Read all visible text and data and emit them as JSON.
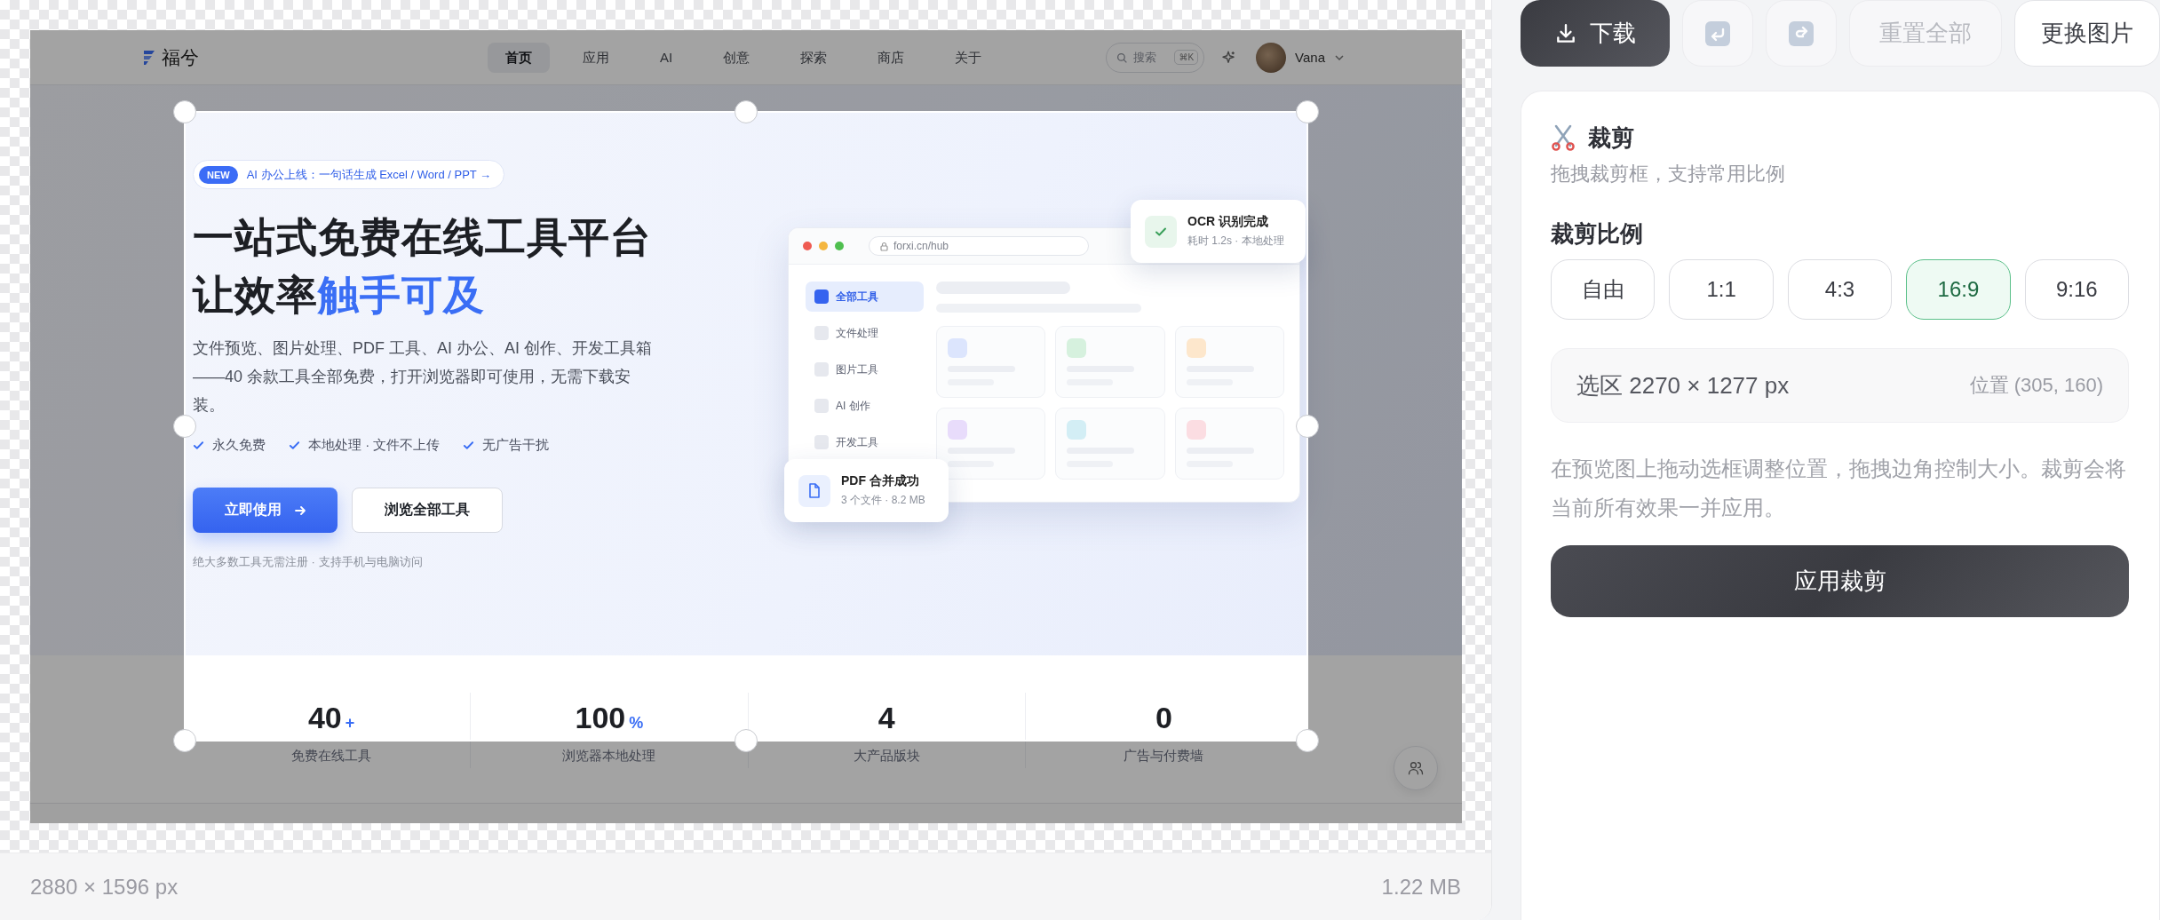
{
  "preview": {
    "nav": {
      "logo": "福兮",
      "items": [
        {
          "label": "首页",
          "selected": true
        },
        {
          "label": "应用",
          "selected": false
        },
        {
          "label": "AI",
          "selected": false
        },
        {
          "label": "创意",
          "selected": false
        },
        {
          "label": "探索",
          "selected": false
        },
        {
          "label": "商店",
          "selected": false
        },
        {
          "label": "关于",
          "selected": false
        }
      ],
      "search": {
        "placeholder": "搜索",
        "shortcut": "⌘K"
      },
      "user": "Vana"
    },
    "hero": {
      "badge_tag": "NEW",
      "badge_text": "AI 办公上线：一句话生成 Excel / Word / PPT →",
      "title_line_1": "一站式免费在线工具平台",
      "title_line_2": "让效率",
      "title_highlight": "触手可及",
      "description": "文件预览、图片处理、PDF 工具、AI 办公、AI 创作、开发工具箱——40 余款工具全部免费，打开浏览器即可使用，无需下载安装。",
      "features": [
        "永久免费",
        "本地处理 · 文件不上传",
        "无广告干扰"
      ],
      "primary_button": "立即使用",
      "secondary_button": "浏览全部工具",
      "note": "绝大多数工具无需注册 · 支持手机与电脑访问"
    },
    "mockup": {
      "url": "forxi.cn/hub",
      "sidebar": [
        {
          "label": "全部工具",
          "selected": true
        },
        {
          "label": "文件处理",
          "selected": false
        },
        {
          "label": "图片工具",
          "selected": false
        },
        {
          "label": "AI 创作",
          "selected": false
        },
        {
          "label": "开发工具",
          "selected": false
        }
      ],
      "cards": [
        {
          "color": "#dce5fd"
        },
        {
          "color": "#d6f1de"
        },
        {
          "color": "#fde7cc"
        },
        {
          "color": "#e8dcfb"
        },
        {
          "color": "#d3eef5"
        },
        {
          "color": "#fbdde2"
        }
      ]
    },
    "toasts": [
      {
        "kind": "success",
        "title": "OCR 识别完成",
        "detail": "耗时 1.2s · 本地处理"
      },
      {
        "kind": "file",
        "title": "PDF 合并成功",
        "detail": "3 个文件 · 8.2 MB"
      }
    ],
    "stats": [
      {
        "value": "40",
        "suffix": "+",
        "label": "免费在线工具"
      },
      {
        "value": "100",
        "suffix": "%",
        "label": "浏览器本地处理"
      },
      {
        "value": "4",
        "label": "大产品版块"
      },
      {
        "value": "0",
        "label": "广告与付费墙"
      }
    ]
  },
  "image_info": {
    "dimensions": "2880 × 1596 px",
    "size": "1.22 MB"
  },
  "toolbar": [
    {
      "kind": "download",
      "label": "下载",
      "disabled": false
    },
    {
      "kind": "undo",
      "disabled": true
    },
    {
      "kind": "redo",
      "disabled": true
    },
    {
      "kind": "reset",
      "label": "重置全部",
      "disabled": true
    },
    {
      "kind": "replace",
      "label": "更换图片",
      "disabled": false
    }
  ],
  "crop_panel": {
    "title": "裁剪",
    "subtitle": "拖拽裁剪框，支持常用比例",
    "ratio_label": "裁剪比例",
    "ratios": [
      {
        "label": "自由",
        "selected": false
      },
      {
        "label": "1:1",
        "selected": false
      },
      {
        "label": "4:3",
        "selected": false
      },
      {
        "label": "16:9",
        "selected": true
      },
      {
        "label": "9:16",
        "selected": false
      }
    ],
    "selection": "选区 2270 × 1277 px",
    "position": "位置 (305, 160)",
    "help": "在预览图上拖动选框调整位置，拖拽边角控制大小。裁剪会将当前所有效果一并应用。",
    "apply_button": "应用裁剪"
  }
}
